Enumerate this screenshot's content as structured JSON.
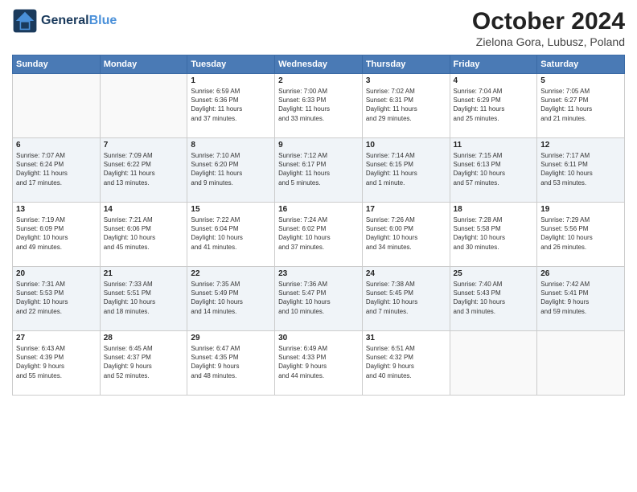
{
  "header": {
    "logo_line1": "General",
    "logo_line2": "Blue",
    "month": "October 2024",
    "location": "Zielona Gora, Lubusz, Poland"
  },
  "days_of_week": [
    "Sunday",
    "Monday",
    "Tuesday",
    "Wednesday",
    "Thursday",
    "Friday",
    "Saturday"
  ],
  "weeks": [
    [
      {
        "day": "",
        "info": ""
      },
      {
        "day": "",
        "info": ""
      },
      {
        "day": "1",
        "info": "Sunrise: 6:59 AM\nSunset: 6:36 PM\nDaylight: 11 hours\nand 37 minutes."
      },
      {
        "day": "2",
        "info": "Sunrise: 7:00 AM\nSunset: 6:33 PM\nDaylight: 11 hours\nand 33 minutes."
      },
      {
        "day": "3",
        "info": "Sunrise: 7:02 AM\nSunset: 6:31 PM\nDaylight: 11 hours\nand 29 minutes."
      },
      {
        "day": "4",
        "info": "Sunrise: 7:04 AM\nSunset: 6:29 PM\nDaylight: 11 hours\nand 25 minutes."
      },
      {
        "day": "5",
        "info": "Sunrise: 7:05 AM\nSunset: 6:27 PM\nDaylight: 11 hours\nand 21 minutes."
      }
    ],
    [
      {
        "day": "6",
        "info": "Sunrise: 7:07 AM\nSunset: 6:24 PM\nDaylight: 11 hours\nand 17 minutes."
      },
      {
        "day": "7",
        "info": "Sunrise: 7:09 AM\nSunset: 6:22 PM\nDaylight: 11 hours\nand 13 minutes."
      },
      {
        "day": "8",
        "info": "Sunrise: 7:10 AM\nSunset: 6:20 PM\nDaylight: 11 hours\nand 9 minutes."
      },
      {
        "day": "9",
        "info": "Sunrise: 7:12 AM\nSunset: 6:17 PM\nDaylight: 11 hours\nand 5 minutes."
      },
      {
        "day": "10",
        "info": "Sunrise: 7:14 AM\nSunset: 6:15 PM\nDaylight: 11 hours\nand 1 minute."
      },
      {
        "day": "11",
        "info": "Sunrise: 7:15 AM\nSunset: 6:13 PM\nDaylight: 10 hours\nand 57 minutes."
      },
      {
        "day": "12",
        "info": "Sunrise: 7:17 AM\nSunset: 6:11 PM\nDaylight: 10 hours\nand 53 minutes."
      }
    ],
    [
      {
        "day": "13",
        "info": "Sunrise: 7:19 AM\nSunset: 6:09 PM\nDaylight: 10 hours\nand 49 minutes."
      },
      {
        "day": "14",
        "info": "Sunrise: 7:21 AM\nSunset: 6:06 PM\nDaylight: 10 hours\nand 45 minutes."
      },
      {
        "day": "15",
        "info": "Sunrise: 7:22 AM\nSunset: 6:04 PM\nDaylight: 10 hours\nand 41 minutes."
      },
      {
        "day": "16",
        "info": "Sunrise: 7:24 AM\nSunset: 6:02 PM\nDaylight: 10 hours\nand 37 minutes."
      },
      {
        "day": "17",
        "info": "Sunrise: 7:26 AM\nSunset: 6:00 PM\nDaylight: 10 hours\nand 34 minutes."
      },
      {
        "day": "18",
        "info": "Sunrise: 7:28 AM\nSunset: 5:58 PM\nDaylight: 10 hours\nand 30 minutes."
      },
      {
        "day": "19",
        "info": "Sunrise: 7:29 AM\nSunset: 5:56 PM\nDaylight: 10 hours\nand 26 minutes."
      }
    ],
    [
      {
        "day": "20",
        "info": "Sunrise: 7:31 AM\nSunset: 5:53 PM\nDaylight: 10 hours\nand 22 minutes."
      },
      {
        "day": "21",
        "info": "Sunrise: 7:33 AM\nSunset: 5:51 PM\nDaylight: 10 hours\nand 18 minutes."
      },
      {
        "day": "22",
        "info": "Sunrise: 7:35 AM\nSunset: 5:49 PM\nDaylight: 10 hours\nand 14 minutes."
      },
      {
        "day": "23",
        "info": "Sunrise: 7:36 AM\nSunset: 5:47 PM\nDaylight: 10 hours\nand 10 minutes."
      },
      {
        "day": "24",
        "info": "Sunrise: 7:38 AM\nSunset: 5:45 PM\nDaylight: 10 hours\nand 7 minutes."
      },
      {
        "day": "25",
        "info": "Sunrise: 7:40 AM\nSunset: 5:43 PM\nDaylight: 10 hours\nand 3 minutes."
      },
      {
        "day": "26",
        "info": "Sunrise: 7:42 AM\nSunset: 5:41 PM\nDaylight: 9 hours\nand 59 minutes."
      }
    ],
    [
      {
        "day": "27",
        "info": "Sunrise: 6:43 AM\nSunset: 4:39 PM\nDaylight: 9 hours\nand 55 minutes."
      },
      {
        "day": "28",
        "info": "Sunrise: 6:45 AM\nSunset: 4:37 PM\nDaylight: 9 hours\nand 52 minutes."
      },
      {
        "day": "29",
        "info": "Sunrise: 6:47 AM\nSunset: 4:35 PM\nDaylight: 9 hours\nand 48 minutes."
      },
      {
        "day": "30",
        "info": "Sunrise: 6:49 AM\nSunset: 4:33 PM\nDaylight: 9 hours\nand 44 minutes."
      },
      {
        "day": "31",
        "info": "Sunrise: 6:51 AM\nSunset: 4:32 PM\nDaylight: 9 hours\nand 40 minutes."
      },
      {
        "day": "",
        "info": ""
      },
      {
        "day": "",
        "info": ""
      }
    ]
  ]
}
